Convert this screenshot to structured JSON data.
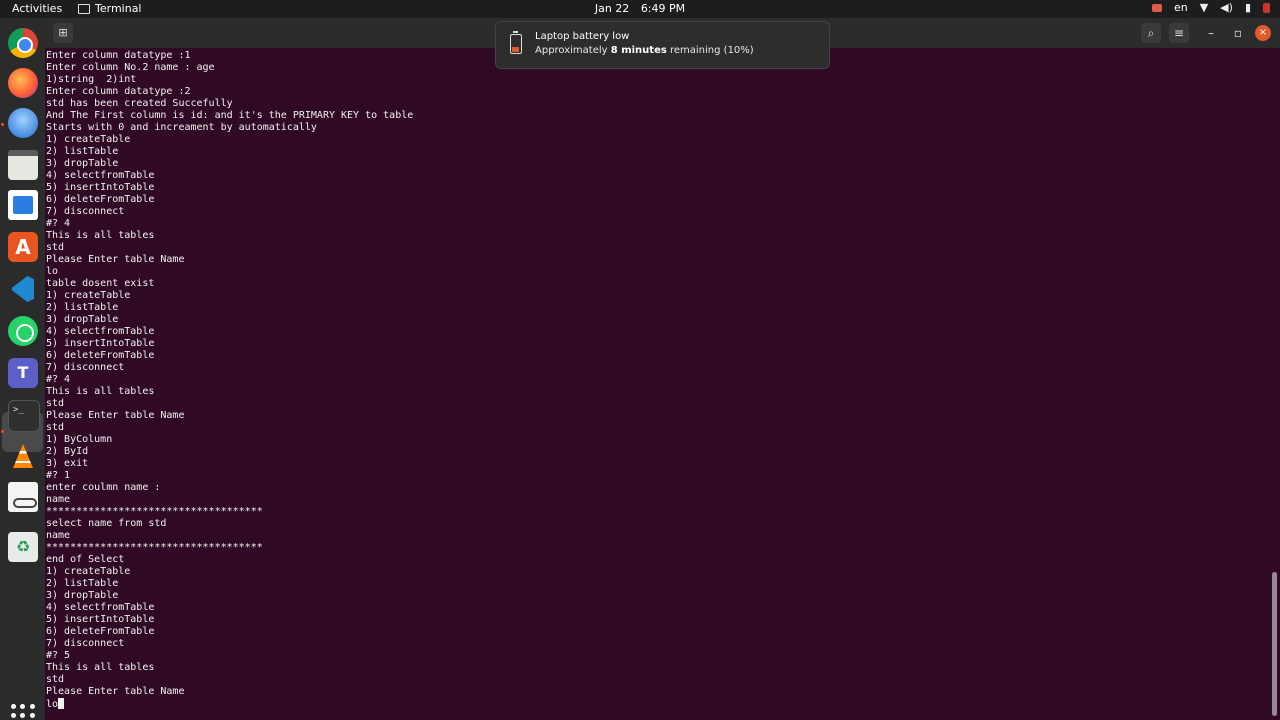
{
  "topbar": {
    "activities": "Activities",
    "app_name": "Terminal",
    "date": "Jan 22",
    "time": "6:49 PM",
    "language": "en"
  },
  "notification": {
    "title": "Laptop battery low",
    "body_prefix": "Approximately ",
    "body_emph": "8 minutes",
    "body_suffix": " remaining (10%)"
  },
  "dock": {
    "icons": [
      "chrome-icon",
      "firefox-icon",
      "thunderbird-icon",
      "files-icon",
      "writer-icon",
      "app-center-icon",
      "vscode-icon",
      "whatsapp-icon",
      "teams-icon",
      "terminal-icon",
      "vlc-icon",
      "document-viewer-icon",
      "trash-icon",
      "show-apps-icon"
    ]
  },
  "terminal": {
    "lines": [
      "Enter column datatype :1",
      "Enter column No.2 name : age",
      "1)string  2)int",
      "Enter column datatype :2",
      "std has been created Succefully",
      "And The First column is id: and it's the PRIMARY KEY to table",
      "Starts with 0 and increament by automatically",
      "1) createTable",
      "2) listTable",
      "3) dropTable",
      "4) selectfromTable",
      "5) insertIntoTable",
      "6) deleteFromTable",
      "7) disconnect",
      "#? 4",
      "This is all tables",
      "std",
      "Please Enter table Name",
      "lo",
      "table dosent exist",
      "1) createTable",
      "2) listTable",
      "3) dropTable",
      "4) selectfromTable",
      "5) insertIntoTable",
      "6) deleteFromTable",
      "7) disconnect",
      "#? 4",
      "This is all tables",
      "std",
      "Please Enter table Name",
      "std",
      "1) ByColumn",
      "2) ById",
      "3) exit",
      "#? 1",
      "enter coulmn name :",
      "name",
      "************************************",
      "select name from std",
      "name",
      "************************************",
      "end of Select",
      "1) createTable",
      "2) listTable",
      "3) dropTable",
      "4) selectfromTable",
      "5) insertIntoTable",
      "6) deleteFromTable",
      "7) disconnect",
      "#? 5",
      "This is all tables",
      "std",
      "Please Enter table Name"
    ],
    "input_line": "lo"
  }
}
